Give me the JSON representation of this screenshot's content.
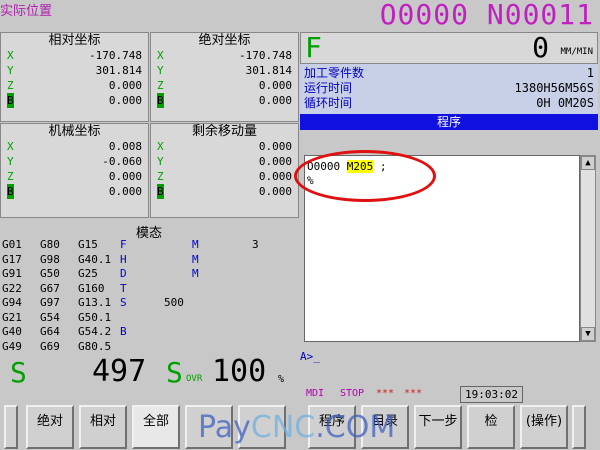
{
  "header": {
    "screen_title": "实际位置",
    "prog_number": "O0000 N00011"
  },
  "relative": {
    "title": "相对坐标",
    "axes": [
      {
        "label": "X",
        "value": "-170.748"
      },
      {
        "label": "Y",
        "value": "301.814"
      },
      {
        "label": "Z",
        "value": "0.000"
      },
      {
        "label": "B",
        "value": "0.000"
      }
    ]
  },
  "absolute": {
    "title": "绝对坐标",
    "axes": [
      {
        "label": "X",
        "value": "-170.748"
      },
      {
        "label": "Y",
        "value": "301.814"
      },
      {
        "label": "Z",
        "value": "0.000"
      },
      {
        "label": "B",
        "value": "0.000"
      }
    ]
  },
  "machine": {
    "title": "机械坐标",
    "axes": [
      {
        "label": "X",
        "value": "0.008"
      },
      {
        "label": "Y",
        "value": "-0.060"
      },
      {
        "label": "Z",
        "value": "0.000"
      },
      {
        "label": "B",
        "value": "0.000"
      }
    ]
  },
  "remaining": {
    "title": "剩余移动量",
    "axes": [
      {
        "label": "X",
        "value": "0.000"
      },
      {
        "label": "Y",
        "value": "0.000"
      },
      {
        "label": "Z",
        "value": "0.000"
      },
      {
        "label": "B",
        "value": "0.000"
      }
    ]
  },
  "modal": {
    "title": "模态",
    "rows": [
      [
        "G01",
        "G80",
        "G15",
        "F",
        "",
        "M",
        "3"
      ],
      [
        "G17",
        "G98",
        "G40.1",
        "H",
        "",
        "M",
        ""
      ],
      [
        "G91",
        "G50",
        "G25",
        "D",
        "",
        "M",
        ""
      ],
      [
        "G22",
        "G67",
        "G160",
        "T",
        "",
        "",
        ""
      ],
      [
        "G94",
        "G97",
        "G13.1",
        "S",
        "500",
        "",
        ""
      ],
      [
        "G21",
        "G54",
        "G50.1",
        "",
        "",
        "",
        ""
      ],
      [
        "G40",
        "G64",
        "G54.2",
        "B",
        "",
        "",
        ""
      ],
      [
        "G49",
        "G69",
        "G80.5",
        "",
        "",
        "",
        ""
      ]
    ]
  },
  "spindle": {
    "s_label": "S",
    "s_value": "497",
    "sovr_s": "S",
    "sovr_sub": "OVR",
    "sovr_value": "100",
    "sovr_unit": "%"
  },
  "feed": {
    "label": "F",
    "value": "0",
    "unit": "MM/MIN"
  },
  "info": {
    "parts_label": "加工零件数",
    "parts_value": "1",
    "run_label": "运行时间",
    "run_value": "1380H56M56S",
    "cycle_label": "循环时间",
    "cycle_value": "0H 0M20S"
  },
  "program": {
    "header": "程序",
    "line1_prefix": "O0000 ",
    "line1_highlight": "M205",
    "line1_suffix": " ;",
    "line2": "%"
  },
  "input_line": "A>_",
  "status": {
    "mode": "MDI",
    "state": "STOP",
    "stars1": "***",
    "stars2": "***",
    "time": "19:03:02"
  },
  "softkeys": [
    "绝对",
    "相对",
    "全部",
    "",
    "",
    "程序",
    "目录",
    "下一步",
    "检",
    "(操作)"
  ],
  "watermark": {
    "pay": "Pay",
    "cnc": "CNC",
    "com": ".COM"
  }
}
